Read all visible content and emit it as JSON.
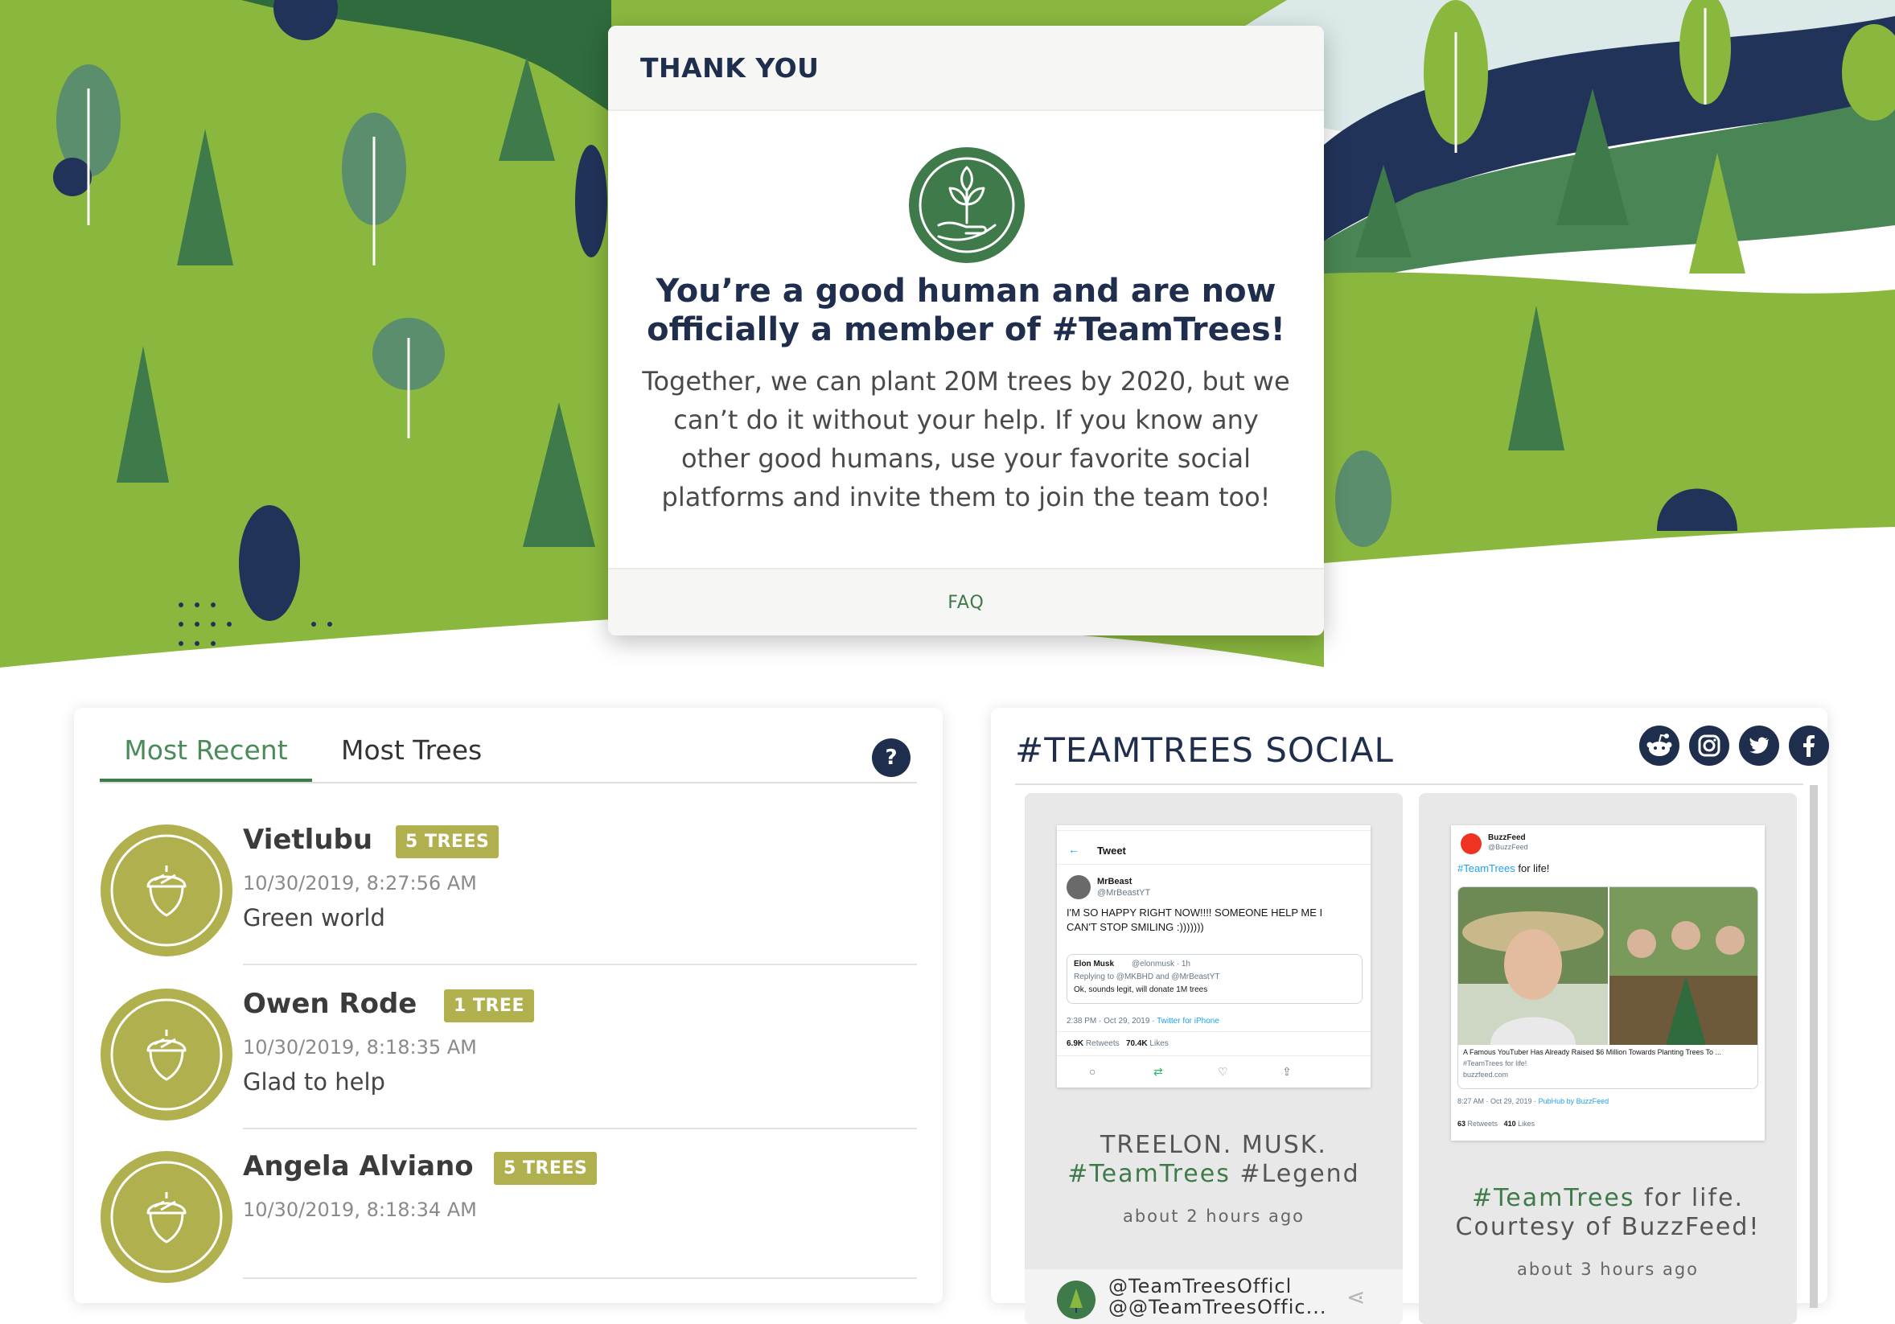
{
  "colors": {
    "navy": "#1f2e4d",
    "green_light": "#8ab83f",
    "green_dark": "#3f7a4a",
    "olive": "#b1b04e"
  },
  "modal": {
    "title": "THANK YOU",
    "logo_icon": "hands-seedling-icon",
    "headline_line1": "You’re a good human and are now",
    "headline_line2": "officially a member of #TeamTrees!",
    "body_line1": "Together, we can plant 20M trees by 2020, but we",
    "body_line2": "can’t do it without your help. If you know any",
    "body_line3": "other good humans, use your favorite social",
    "body_line4": "platforms and invite them to join the team too!",
    "faq_label": "FAQ"
  },
  "leaderboard": {
    "tabs": [
      {
        "label": "Most Recent",
        "active": true
      },
      {
        "label": "Most Trees",
        "active": false
      }
    ],
    "help_label": "?",
    "entries": [
      {
        "name": "Vietlubu",
        "badge": "5 TREES",
        "time": "10/30/2019, 8:27:56 AM",
        "message": "Green world",
        "icon": "acorn-icon"
      },
      {
        "name": "Owen Rode",
        "badge": "1 TREE",
        "time": "10/30/2019, 8:18:35 AM",
        "message": "Glad to help",
        "icon": "acorn-icon"
      },
      {
        "name": "Angela Alviano",
        "badge": "5 TREES",
        "time": "10/30/2019, 8:18:34 AM",
        "message": "",
        "icon": "acorn-icon"
      }
    ]
  },
  "social": {
    "title": "#TEAMTREES SOCIAL",
    "icons": [
      "reddit-icon",
      "instagram-icon",
      "twitter-icon",
      "facebook-icon"
    ],
    "posts": [
      {
        "caption_line1": "TREELON. MUSK.",
        "caption_hash": "#TeamTrees",
        "caption_rest": " #Legend",
        "age": "about 2 hours ago",
        "handle_line1": "@TeamTreesOfficl",
        "handle_line2": "@@TeamTreesOffic...",
        "tweet": {
          "header": "Tweet",
          "author": "MrBeast",
          "author_handle": "@MrBeastYT",
          "text_line1": "I'M SO HAPPY RIGHT NOW!!!! SOMEONE HELP ME I",
          "text_line2": "CAN'T STOP SMILING :)))))))",
          "quote_author": "Elon Musk",
          "quote_meta": "@elonmusk · 1h",
          "quote_reply": "Replying to @MKBHD and @MrBeastYT",
          "quote_text": "Ok, sounds legit, will donate 1M trees",
          "timestamp": "2:38 PM · Oct 29, 2019 · ",
          "source": "Twitter for iPhone",
          "retweets": "6.9K",
          "retweets_label": "Retweets",
          "likes": "70.4K",
          "likes_label": "Likes"
        }
      },
      {
        "caption_hash": "#TeamTrees",
        "caption_rest": " for life.",
        "caption_line2": "Courtesy of BuzzFeed!",
        "age": "about 3 hours ago",
        "tweet": {
          "author": "BuzzFeed",
          "author_handle": "@BuzzFeed",
          "text_hash": "#TeamTrees",
          "text_rest": " for life!",
          "link_title": "A Famous YouTuber Has Already Raised $6 Million Towards Planting Trees To ...",
          "link_sub": "#TeamTrees for life!",
          "link_domain": "buzzfeed.com",
          "timestamp": "8:27 AM · Oct 29, 2019 · ",
          "source": "PubHub by BuzzFeed",
          "retweets": "63",
          "retweets_label": "Retweets",
          "likes": "410",
          "likes_label": "Likes"
        }
      }
    ]
  }
}
